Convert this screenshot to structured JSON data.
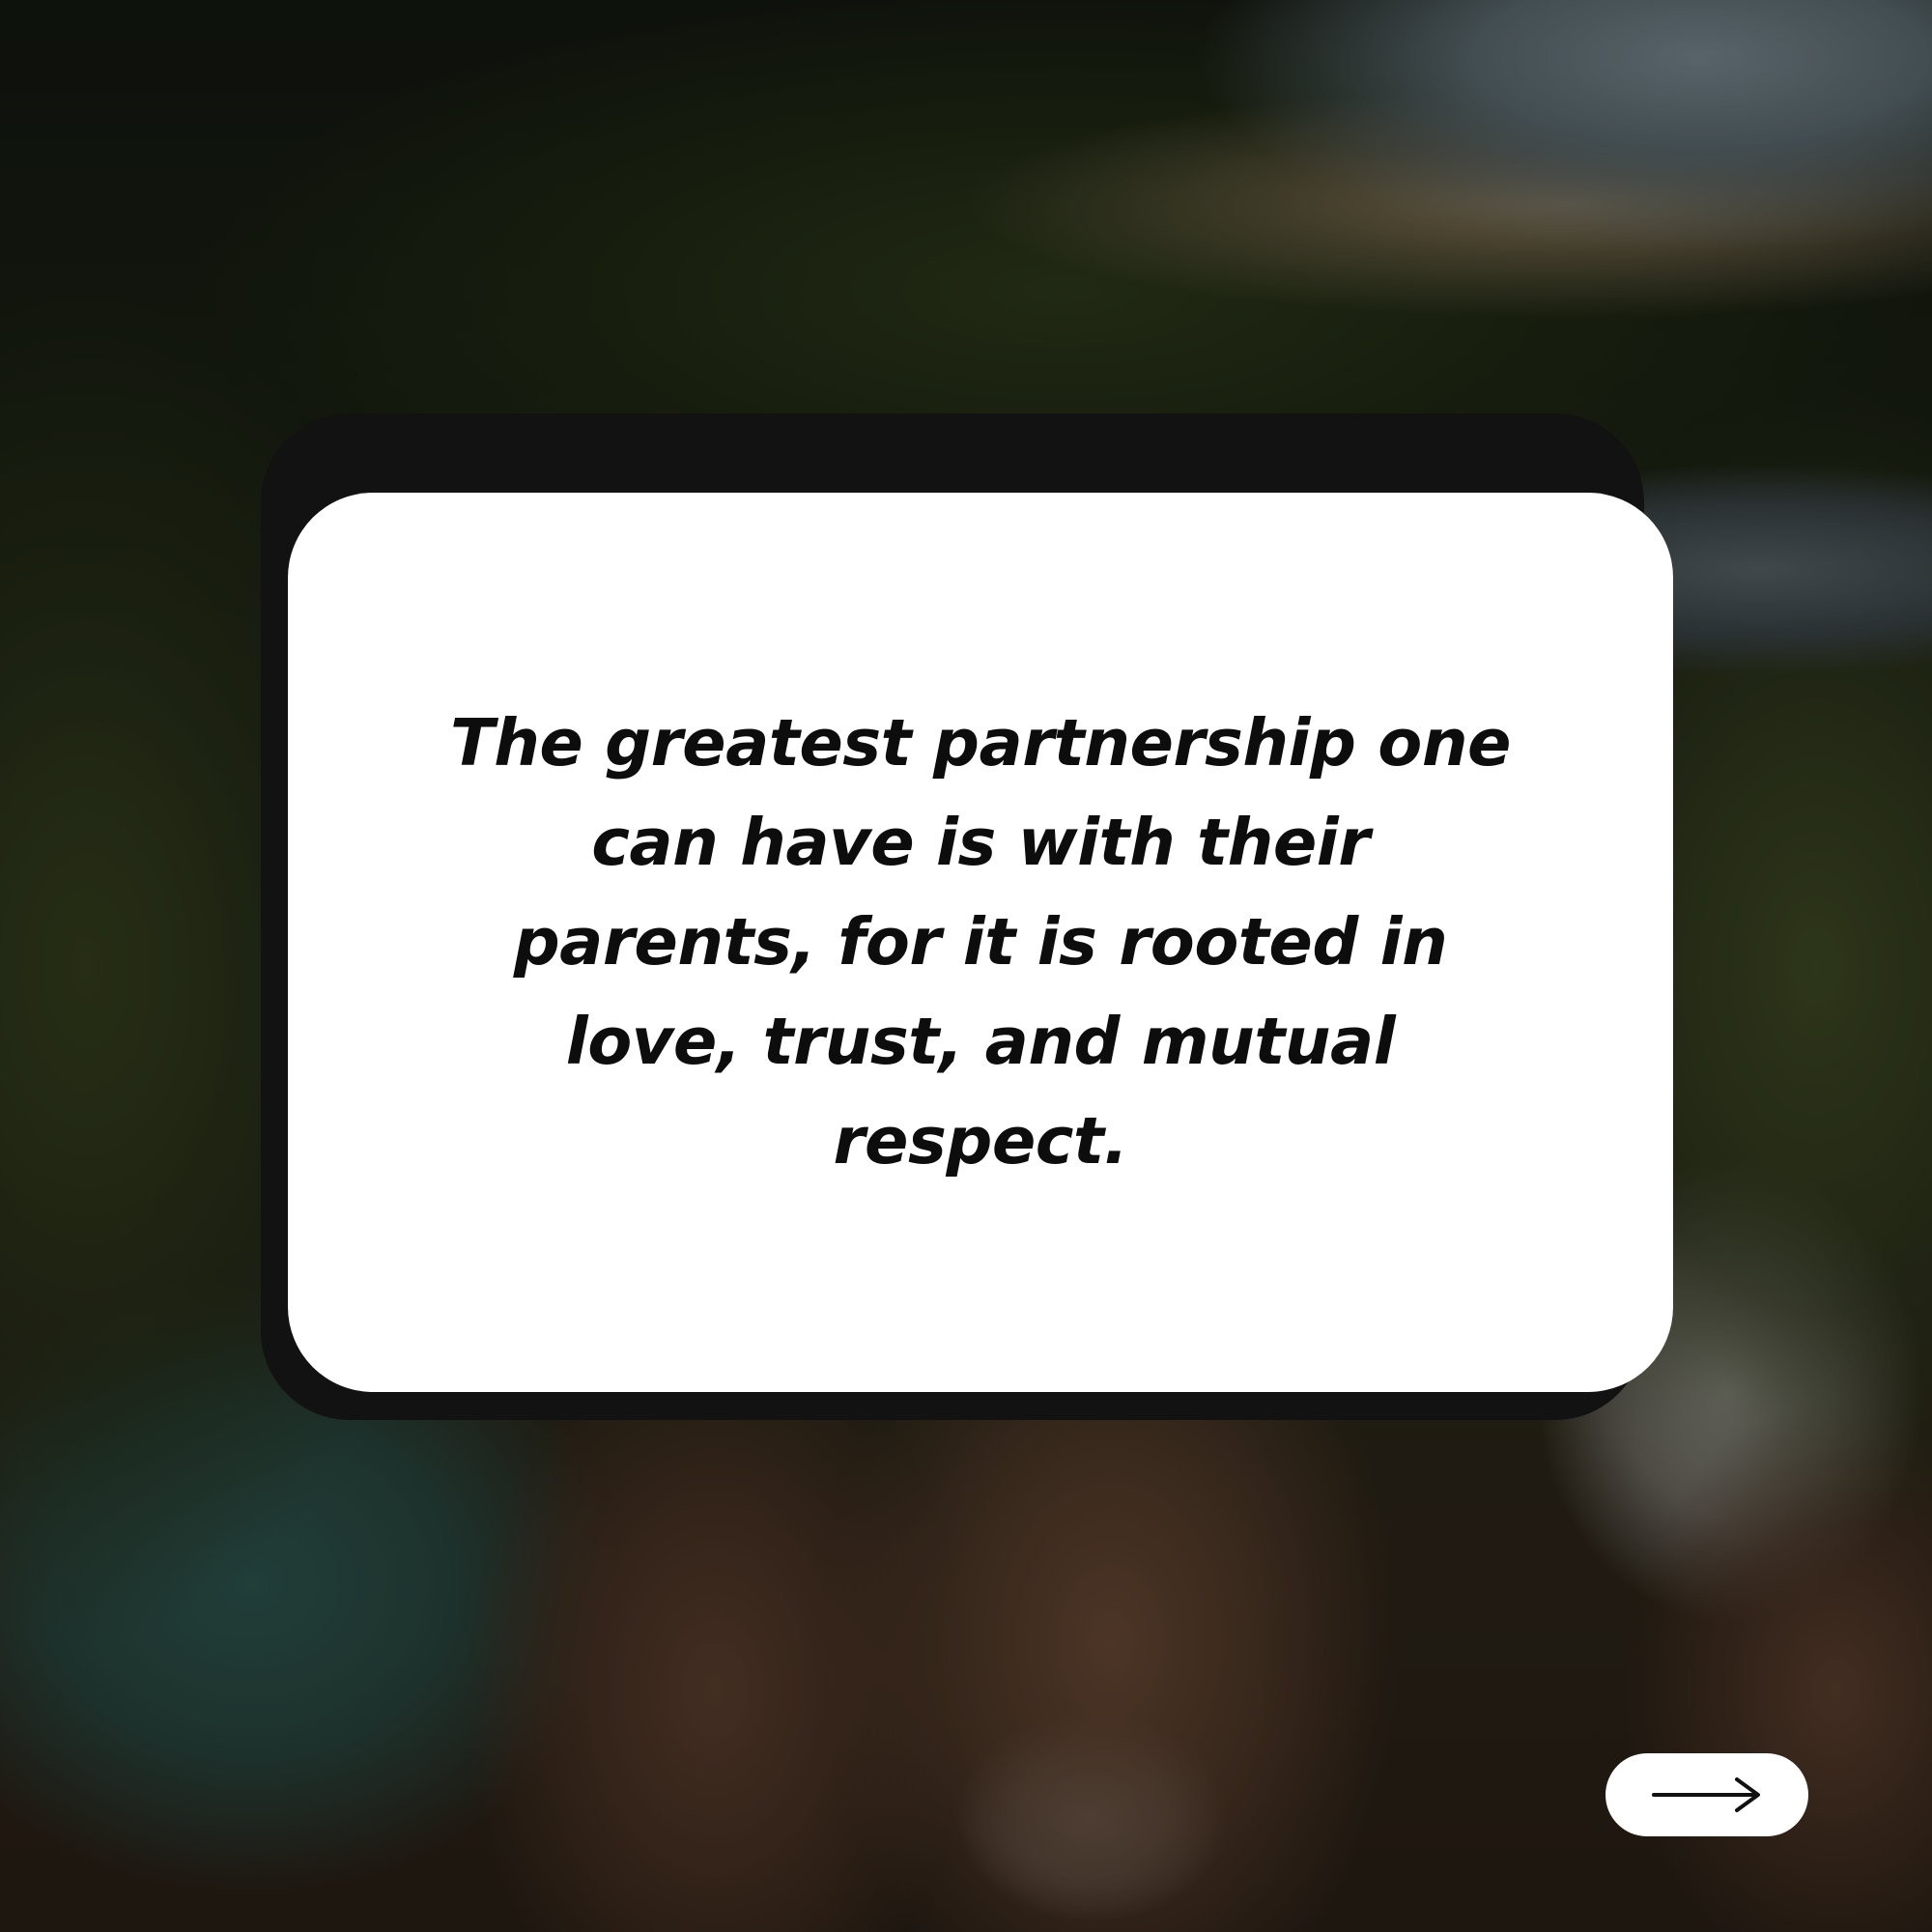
{
  "quote_card": {
    "text": "The greatest partnership one can have is with their parents, for it is rooted in love, trust, and mutual respect."
  },
  "next_button": {
    "icon": "arrow-right-icon"
  },
  "colors": {
    "card_background": "#ffffff",
    "card_shadow": "#121212",
    "text": "#0d0d0d",
    "button_background": "#ffffff"
  }
}
